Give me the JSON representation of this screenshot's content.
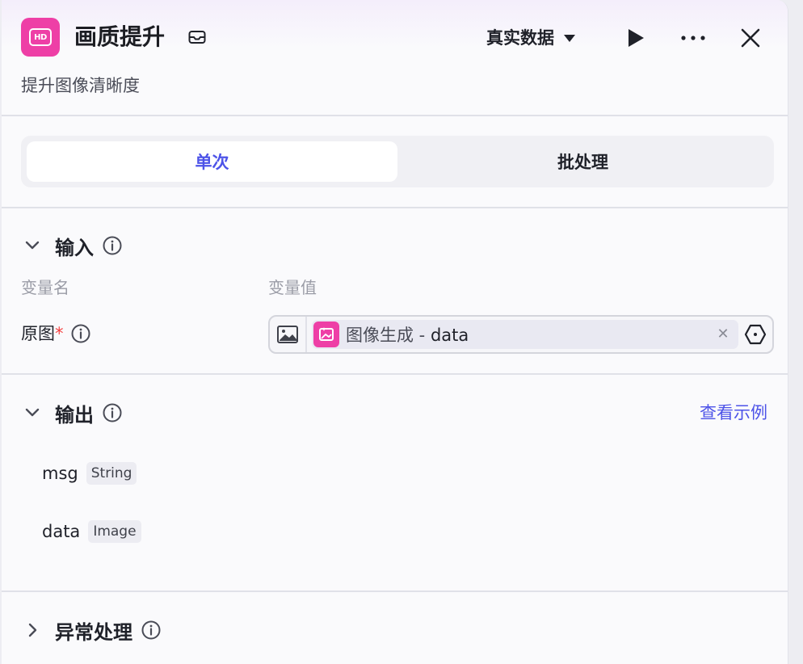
{
  "header": {
    "title": "画质提升",
    "subtitle": "提升图像清晰度",
    "data_mode": "真实数据",
    "icons": {
      "app": "hd-icon",
      "title_badge": "inbox-icon",
      "run": "play-icon",
      "more": "more-horizontal-icon",
      "close": "close-icon"
    }
  },
  "tabs": [
    {
      "label": "单次",
      "active": true
    },
    {
      "label": "批处理",
      "active": false
    }
  ],
  "input": {
    "title": "输入",
    "col_name": "变量名",
    "col_value": "变量值",
    "fields": [
      {
        "label": "原图",
        "required": "*",
        "value_source": "图像生成",
        "value_sep": " - ",
        "value_var": "data"
      }
    ]
  },
  "output": {
    "title": "输出",
    "example_link": "查看示例",
    "items": [
      {
        "name": "msg",
        "type": "String"
      },
      {
        "name": "data",
        "type": "Image"
      }
    ]
  },
  "error_handling": {
    "title": "异常处理"
  },
  "colors": {
    "accent": "#4d53e8",
    "brand_pink": "#ee3fa6",
    "required": "#f53f3f"
  }
}
